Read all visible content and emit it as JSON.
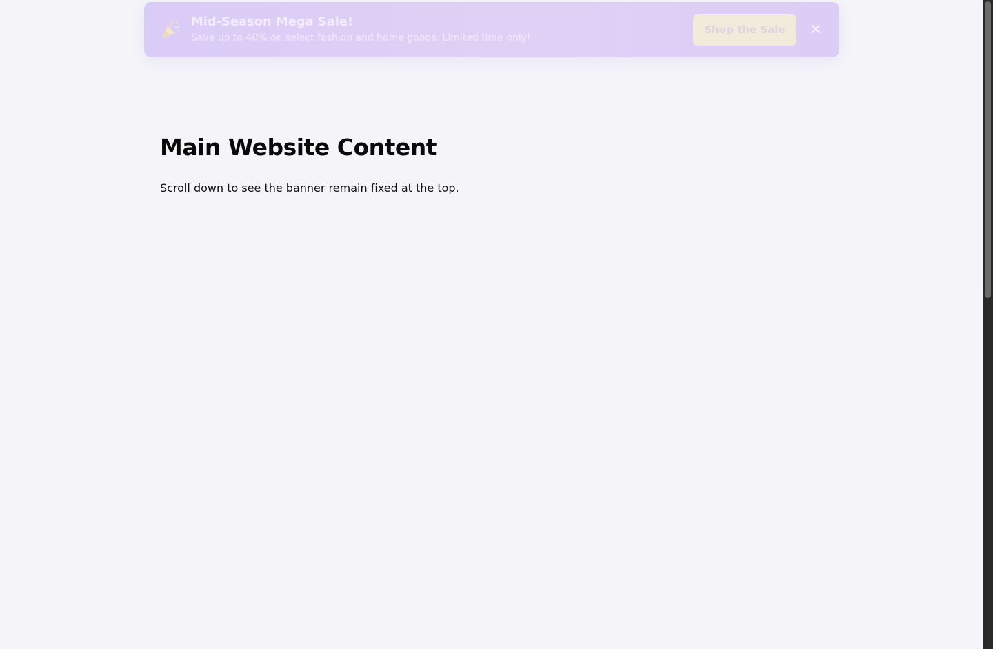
{
  "banner": {
    "icon": "party-popper-icon",
    "title": "Mid-Season Mega Sale!",
    "subtitle": "Save up to 40% on select fashion and home goods. Limited time only!",
    "cta_label": "Shop the Sale",
    "close_icon": "close-icon"
  },
  "main": {
    "heading": "Main Website Content",
    "paragraph": "Scroll down to see the banner remain fixed at the top."
  },
  "colors": {
    "page_background": "#f4f4f9",
    "banner_background": "#dccdf6",
    "cta_background": "#f2ebdc",
    "scrollbar_track": "#2a2a2a",
    "scrollbar_thumb": "#6b6b6b"
  }
}
